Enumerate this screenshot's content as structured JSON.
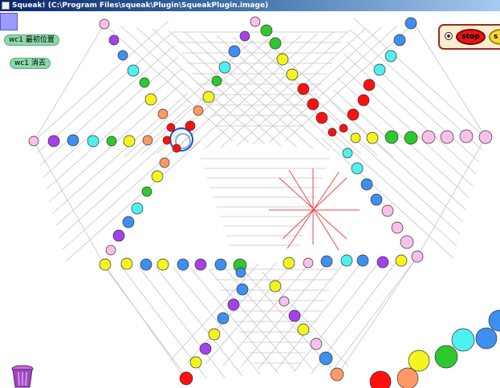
{
  "window": {
    "title": "Squeak! (C:\\Program Files\\squeak\\Plugin\\SqueakPlugin.image)"
  },
  "buttons": {
    "init_label": "wc1 最初位置",
    "erase_label": "wc1 消去",
    "stop_label": "stop",
    "step_label": "s"
  },
  "icons": {
    "trash": "trash-can-icon",
    "flap": "flap-tab-icon",
    "radio": "radio-icon"
  },
  "colors": {
    "pink": "#f9c0ea",
    "purple": "#a640e8",
    "blue": "#3d8ff0",
    "cyan": "#4ff0f0",
    "green": "#2ec82e",
    "yellow": "#f5f51e",
    "orange": "#ff9966",
    "red": "#ff1010",
    "lines": "#c4c4c4",
    "red_lines": "#e84848"
  }
}
